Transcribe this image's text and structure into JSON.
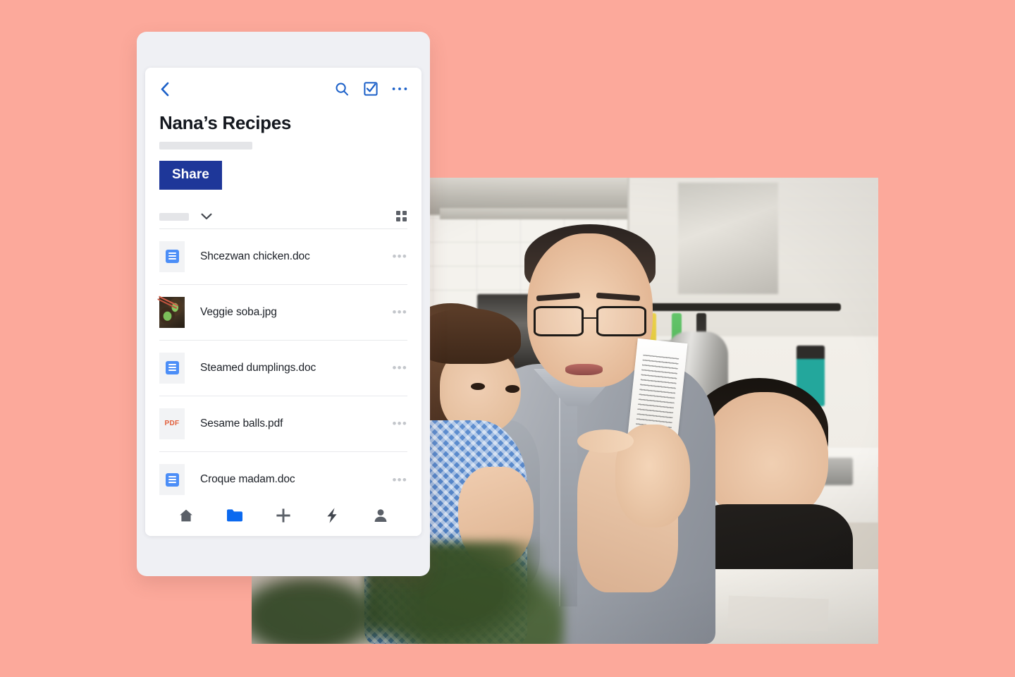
{
  "background": {
    "color": "#fca99b"
  },
  "app": {
    "topbar": {
      "back_icon": "chevron-left-icon",
      "search_icon": "search-icon",
      "select_icon": "checkbox-checked-icon",
      "more_icon": "more-horizontal-icon",
      "accent_color": "#1e64c8"
    },
    "header": {
      "title": "Nana’s Recipes",
      "meta_placeholder": "",
      "share_label": "Share",
      "share_color": "#1e3799"
    },
    "sort_row": {
      "sort_placeholder": "",
      "chevron_icon": "chevron-down-icon",
      "view_icon": "grid-view-icon"
    },
    "files": [
      {
        "name": "Shcezwan chicken.doc",
        "kind": "doc",
        "more": "•••"
      },
      {
        "name": "Veggie soba.jpg",
        "kind": "image",
        "more": "•••"
      },
      {
        "name": "Steamed dumplings.doc",
        "kind": "doc",
        "more": "•••"
      },
      {
        "name": "Sesame balls.pdf",
        "kind": "pdf",
        "badge": "PDF",
        "more": "•••"
      },
      {
        "name": "Croque madam.doc",
        "kind": "doc",
        "more": "•••"
      }
    ],
    "bottom_nav": [
      {
        "icon": "home-icon",
        "active": false
      },
      {
        "icon": "folder-icon",
        "active": true
      },
      {
        "icon": "plus-icon",
        "active": false
      },
      {
        "icon": "lightning-bolt-icon",
        "active": false
      },
      {
        "icon": "person-icon",
        "active": false
      }
    ],
    "nav_active_color": "#0b69ef",
    "nav_inactive_color": "#5b6068"
  },
  "photo": {
    "alt": "Father in kitchen reading a recipe card with a toddler and a boy",
    "scene": "kitchen"
  }
}
